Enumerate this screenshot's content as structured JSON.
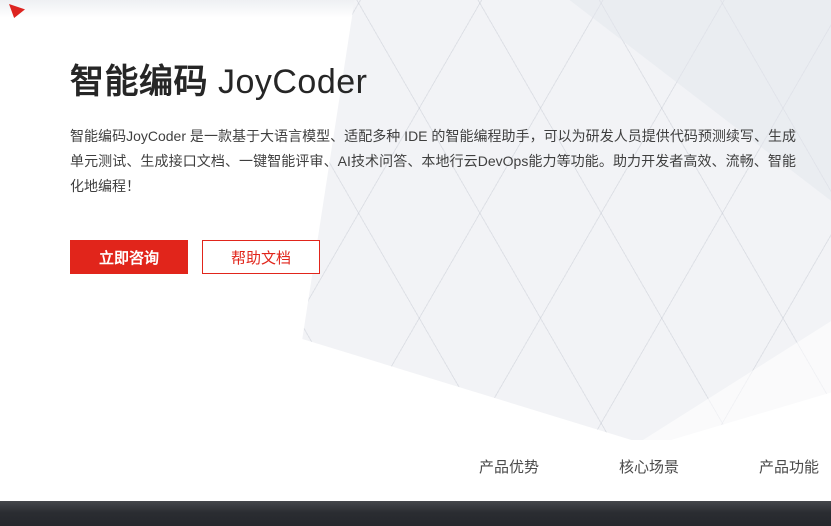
{
  "page": {
    "hero": {
      "title_cn": "智能编码",
      "title_en": " JoyCoder",
      "description": "智能编码JoyCoder 是一款基于大语言模型、适配多种 IDE 的智能编程助手，可以为研发人员提供代码预测续写、生成单元测试、生成接口文档、一键智能评审、AI技术问答、本地行云DevOps能力等功能。助力开发者高效、流畅、智能化地编程！",
      "primary_button": "立即咨询",
      "secondary_button": "帮助文档"
    },
    "subnav": {
      "items": [
        {
          "label": "产品优势"
        },
        {
          "label": "核心场景"
        },
        {
          "label": "产品功能"
        }
      ]
    },
    "colors": {
      "brand_red": "#e1251b",
      "footer_bar": "#2b2d32",
      "pattern_base": "#f2f3f6"
    }
  }
}
